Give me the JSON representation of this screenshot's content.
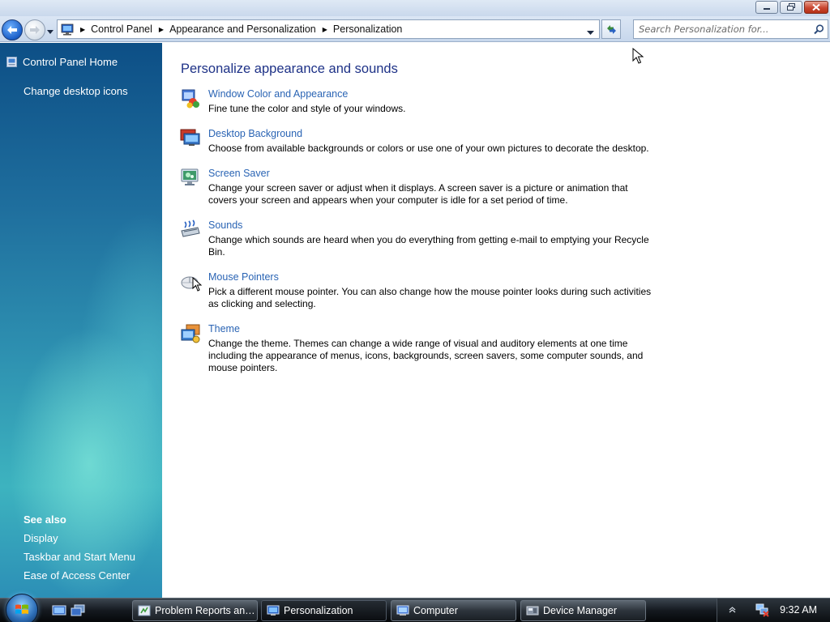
{
  "window": {
    "caption_buttons": [
      "minimize",
      "maximize",
      "close"
    ]
  },
  "navbar": {
    "breadcrumb": [
      "Control Panel",
      "Appearance and Personalization",
      "Personalization"
    ],
    "search_placeholder": "Search Personalization for..."
  },
  "sidebar": {
    "home_label": "Control Panel Home",
    "tasks": [
      "Change desktop icons"
    ],
    "see_also_title": "See also",
    "see_also": [
      "Display",
      "Taskbar and Start Menu",
      "Ease of Access Center"
    ]
  },
  "main": {
    "title": "Personalize appearance and sounds",
    "items": [
      {
        "icon": "window-color-icon",
        "link": "Window Color and Appearance",
        "desc": "Fine tune the color and style of your windows."
      },
      {
        "icon": "desktop-background-icon",
        "link": "Desktop Background",
        "desc": "Choose from available backgrounds or colors or use one of your own pictures to decorate the desktop."
      },
      {
        "icon": "screen-saver-icon",
        "link": "Screen Saver",
        "desc": "Change your screen saver or adjust when it displays. A screen saver is a picture or animation that covers your screen and appears when your computer is idle for a set period of time."
      },
      {
        "icon": "sounds-icon",
        "link": "Sounds",
        "desc": "Change which sounds are heard when you do everything from getting e-mail to emptying your Recycle Bin."
      },
      {
        "icon": "mouse-pointers-icon",
        "link": "Mouse Pointers",
        "desc": "Pick a different mouse pointer. You can also change how the mouse pointer looks during such activities as clicking and selecting."
      },
      {
        "icon": "theme-icon",
        "link": "Theme",
        "desc": "Change the theme. Themes can change a wide range of visual and auditory elements at one time including the appearance of menus, icons, backgrounds, screen savers, some computer sounds, and mouse pointers."
      }
    ]
  },
  "taskbar": {
    "buttons": [
      {
        "label": "Problem Reports and Solutions",
        "active": false
      },
      {
        "label": "Personalization",
        "active": true
      },
      {
        "label": "Computer",
        "active": false
      },
      {
        "label": "Device Manager",
        "active": false
      }
    ],
    "clock": "9:32 AM"
  }
}
